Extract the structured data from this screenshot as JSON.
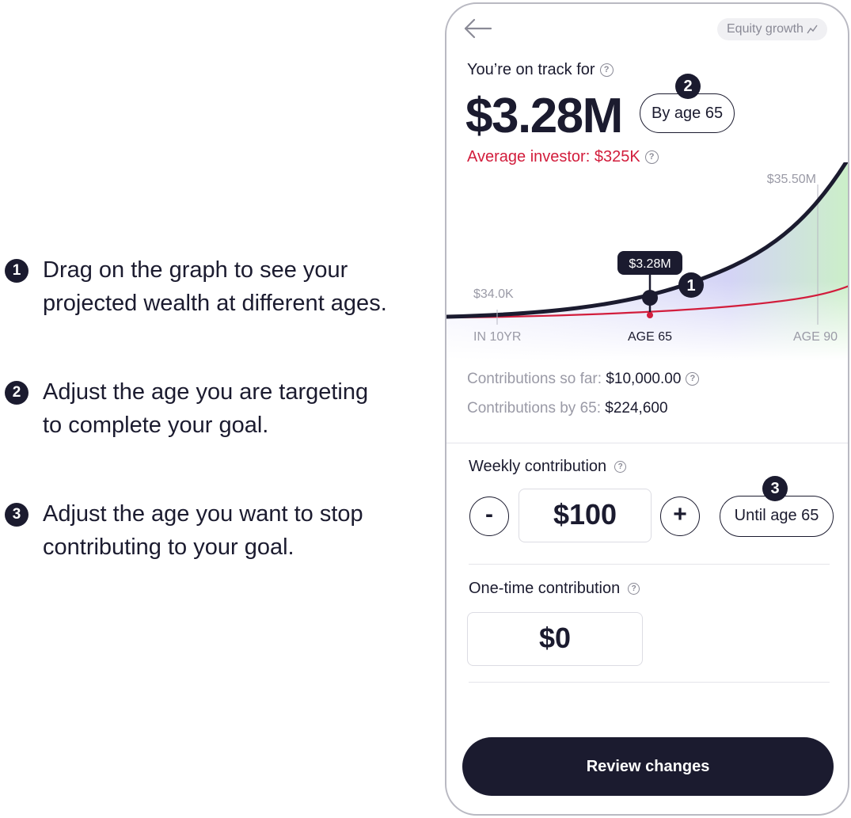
{
  "annotations": [
    {
      "number": "1",
      "text": "Drag on the graph to see your projected wealth at different ages."
    },
    {
      "number": "2",
      "text": "Adjust the age you are targeting\nto complete your goal."
    },
    {
      "number": "3",
      "text": "Adjust the age you want to stop contributing to your goal."
    }
  ],
  "header": {
    "equity_pill": "Equity growth"
  },
  "summary": {
    "track_label": "You’re on track for",
    "amount": "$3.28M",
    "age_pill": "By age 65",
    "average_investor": "Average investor: $325K"
  },
  "chart": {
    "max_label": "$35.50M",
    "tooltip": "$3.28M",
    "start_label": "$34.0K",
    "x_labels": [
      "IN 10YR",
      "AGE 65",
      "AGE 90"
    ],
    "marker": "1",
    "colors": {
      "user_line": "#1b1b2f",
      "average_line": "#d21d3c"
    }
  },
  "markers": {
    "age_pill": "2",
    "until_pill": "3"
  },
  "contributions": {
    "so_far_label": "Contributions so far:",
    "so_far_value": "$10,000.00",
    "by_label": "Contributions by 65:",
    "by_value": "$224,600"
  },
  "weekly": {
    "label": "Weekly contribution",
    "minus": "-",
    "value": "$100",
    "plus": "+",
    "until": "Until age 65"
  },
  "one_time": {
    "label": "One-time contribution",
    "value": "$0"
  },
  "review_button": "Review changes"
}
